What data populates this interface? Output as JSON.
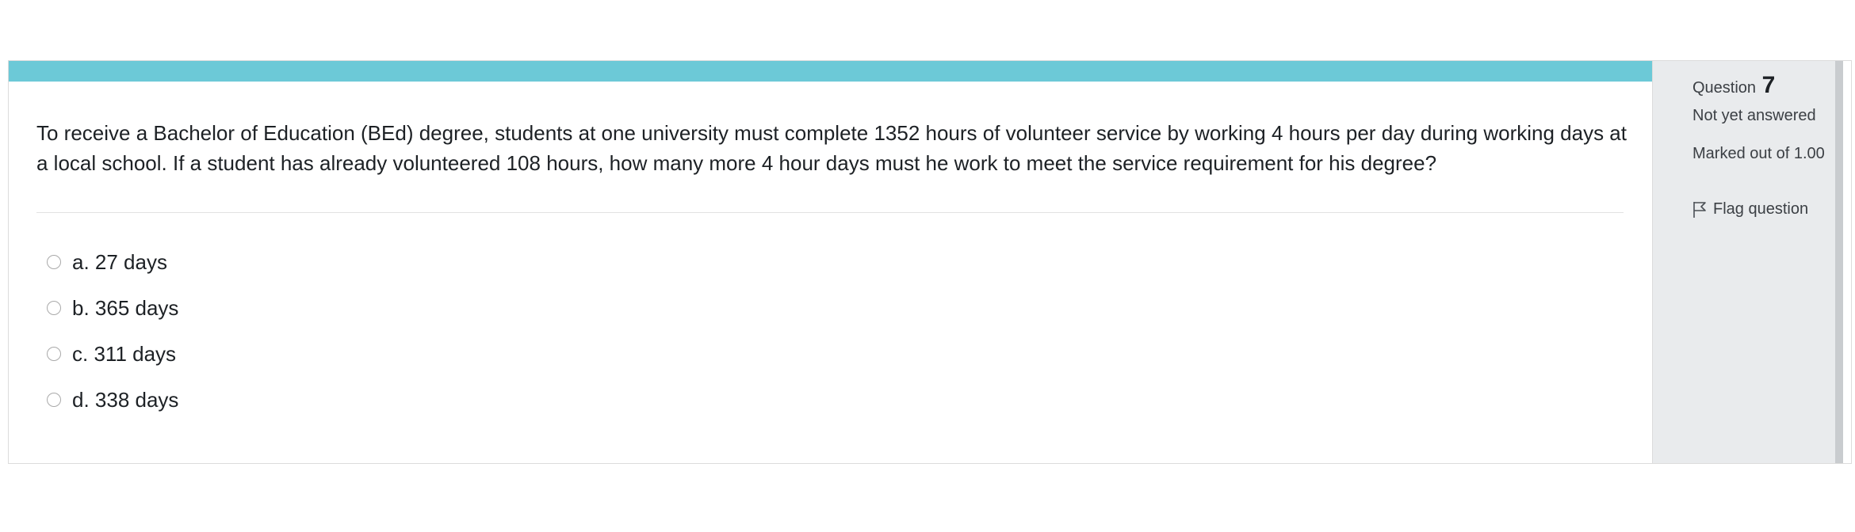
{
  "question": {
    "text": "To receive a Bachelor of Education (BEd) degree, students at one university must complete 1352 hours of volunteer service by working 4 hours per day during working days at a local school. If a student has already volunteered 108 hours, how many more 4 hour days must he work to meet the service requirement for his degree?",
    "answers": [
      {
        "label": "a. 27 days"
      },
      {
        "label": "b. 365 days"
      },
      {
        "label": "c. 311 days"
      },
      {
        "label": "d. 338 days"
      }
    ]
  },
  "info": {
    "question_label": "Question",
    "question_number": "7",
    "state": "Not yet answered",
    "grade": "Marked out of 1.00",
    "flag_label": "Flag question",
    "flag_icon": "flag-icon"
  },
  "colors": {
    "accent": "#6cc9d7",
    "info_background": "#e9ebed"
  }
}
